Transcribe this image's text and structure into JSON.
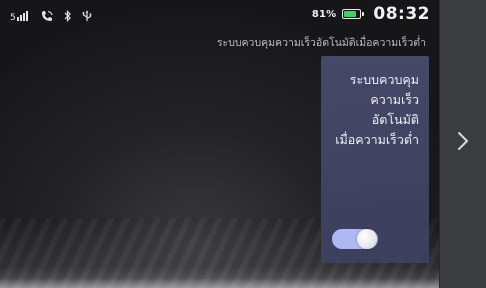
{
  "status_bar": {
    "signal_icon": "signal-icon",
    "phone_icon": "phone-connected-icon",
    "bluetooth_icon": "bluetooth-icon",
    "usb_icon": "usb-icon",
    "battery_percent": "81%",
    "battery_level": 0.81,
    "battery_color": "#3fcf6a",
    "time": "08:32"
  },
  "header": {
    "subtitle": "ระบบควบคุมความเร็วอัตโนมัติเมื่อความเร็วต่ำ"
  },
  "feature_card": {
    "label_lines": [
      "ระบบควบคุม",
      "ความเร็ว",
      "อัตโนมัติ",
      "เมื่อความเร็วต่ำ"
    ],
    "toggle_state": "on",
    "toggle_color": "#aeb9f4",
    "card_color": "#4a4c6e"
  },
  "navigation": {
    "next_icon": "chevron-right-icon"
  }
}
